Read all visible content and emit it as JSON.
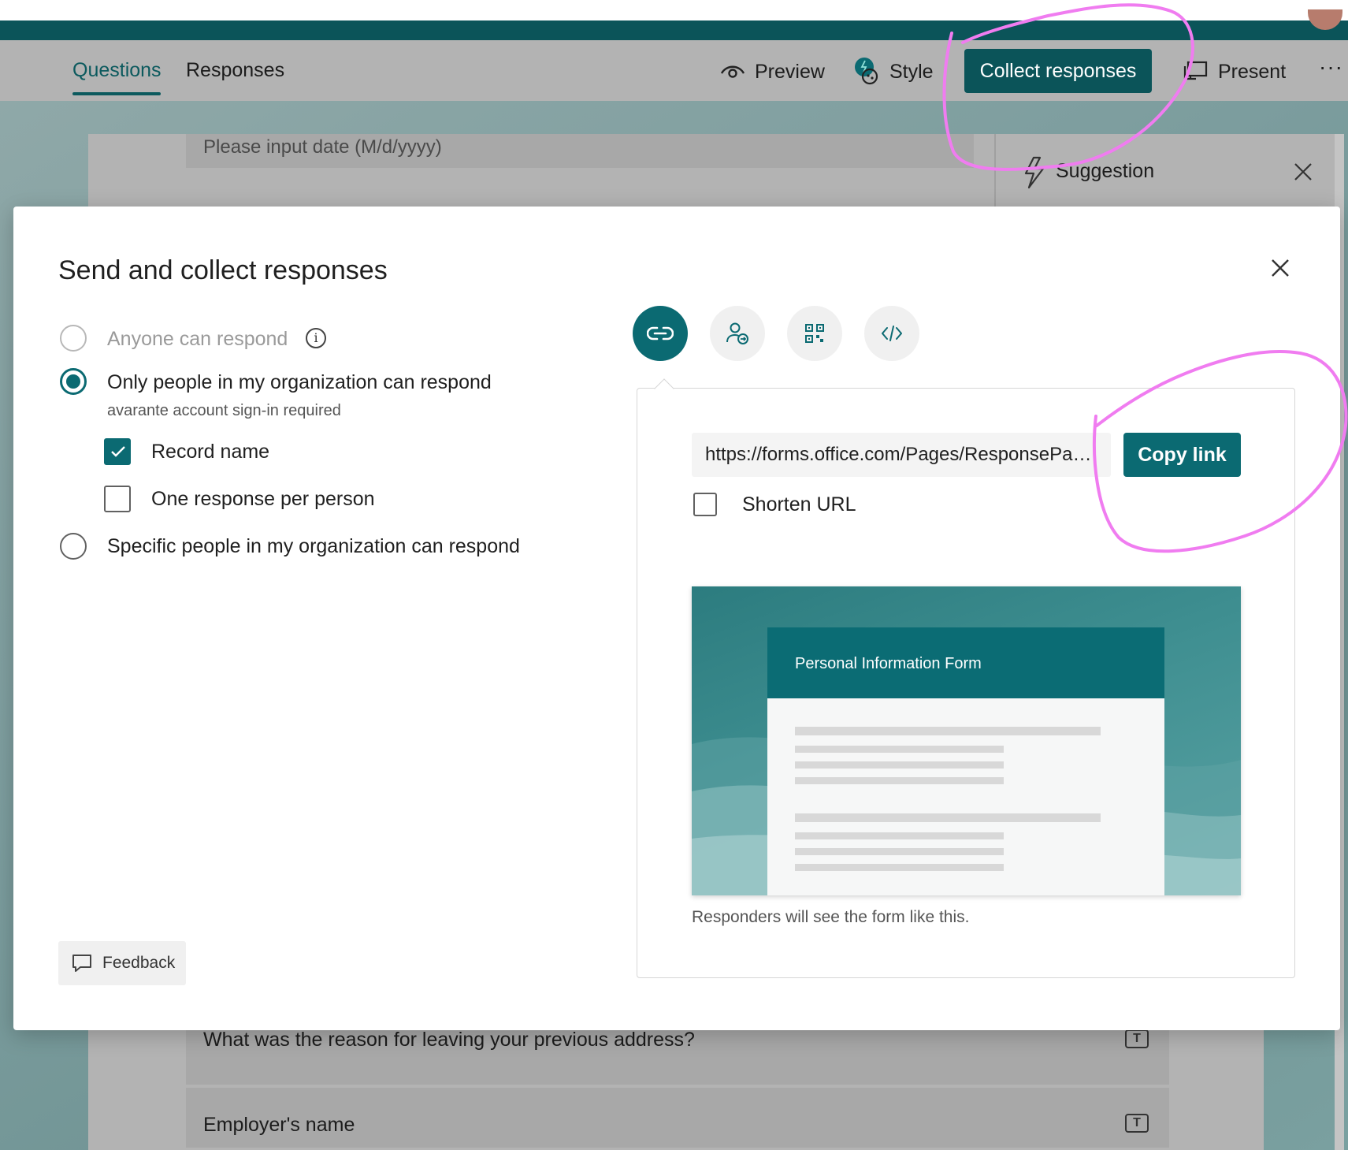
{
  "header": {
    "tabs": [
      {
        "label": "Questions",
        "active": true
      },
      {
        "label": "Responses",
        "active": false
      }
    ],
    "commands": {
      "preview": "Preview",
      "style": "Style",
      "collect": "Collect responses",
      "present": "Present",
      "more": "···"
    }
  },
  "background": {
    "date_placeholder": "Please input date (M/d/yyyy)",
    "suggestion_title": "Suggestion",
    "questions": [
      {
        "text": "What was the reason for leaving your previous address?",
        "type_icon": "T"
      },
      {
        "text": "Employer's name",
        "type_icon": "T"
      }
    ]
  },
  "modal": {
    "title": "Send and collect responses",
    "options": {
      "anyone": {
        "label": "Anyone can respond",
        "enabled": false,
        "selected": false
      },
      "org": {
        "label": "Only people in my organization can respond",
        "sublabel": "avarante account sign-in required",
        "selected": true
      },
      "record_name": {
        "label": "Record name",
        "checked": true
      },
      "one_response": {
        "label": "One response per person",
        "checked": false
      },
      "specific": {
        "label": "Specific people in my organization can respond",
        "selected": false
      }
    },
    "feedback_label": "Feedback",
    "share_tabs": [
      {
        "icon": "link-icon",
        "active": true
      },
      {
        "icon": "invite-people-icon",
        "active": false
      },
      {
        "icon": "qr-code-icon",
        "active": false
      },
      {
        "icon": "embed-code-icon",
        "active": false
      }
    ],
    "share": {
      "url": "https://forms.office.com/Pages/ResponsePage.aspx",
      "copy_label": "Copy link",
      "shorten_label": "Shorten URL",
      "shorten_checked": false
    },
    "preview": {
      "form_title": "Personal Information Form",
      "caption": "Responders will see the form like this."
    }
  },
  "colors": {
    "brand_teal": "#0b6a72",
    "appbar": "#0b5459",
    "annotation_pink": "#f07cf0"
  }
}
